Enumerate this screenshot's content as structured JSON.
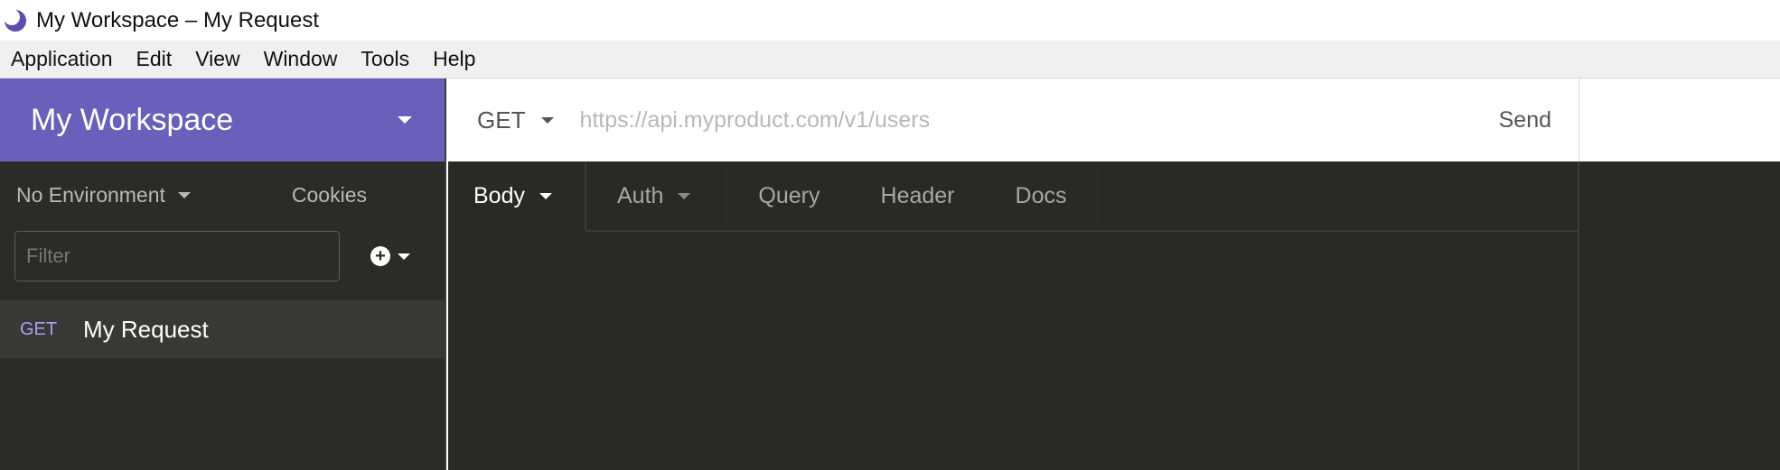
{
  "window": {
    "title": "My Workspace – My Request",
    "logo_icon": "insomnia-moon-icon"
  },
  "menu": [
    "Application",
    "Edit",
    "View",
    "Window",
    "Tools",
    "Help"
  ],
  "sidebar": {
    "workspace_name": "My Workspace",
    "environment": "No Environment",
    "cookies_label": "Cookies",
    "filter_placeholder": "Filter",
    "requests": [
      {
        "method": "GET",
        "name": "My Request"
      }
    ]
  },
  "request": {
    "method": "GET",
    "url_placeholder": "https://api.myproduct.com/v1/users",
    "send_label": "Send"
  },
  "tabs": [
    {
      "label": "Body",
      "dropdown": true
    },
    {
      "label": "Auth",
      "dropdown": true
    },
    {
      "label": "Query"
    },
    {
      "label": "Header"
    },
    {
      "label": "Docs"
    }
  ],
  "colors": {
    "accent": "#6a5fba",
    "sidebar_bg": "#2b2b27",
    "content_bg": "#292925",
    "method_get": "#a99ff5"
  }
}
